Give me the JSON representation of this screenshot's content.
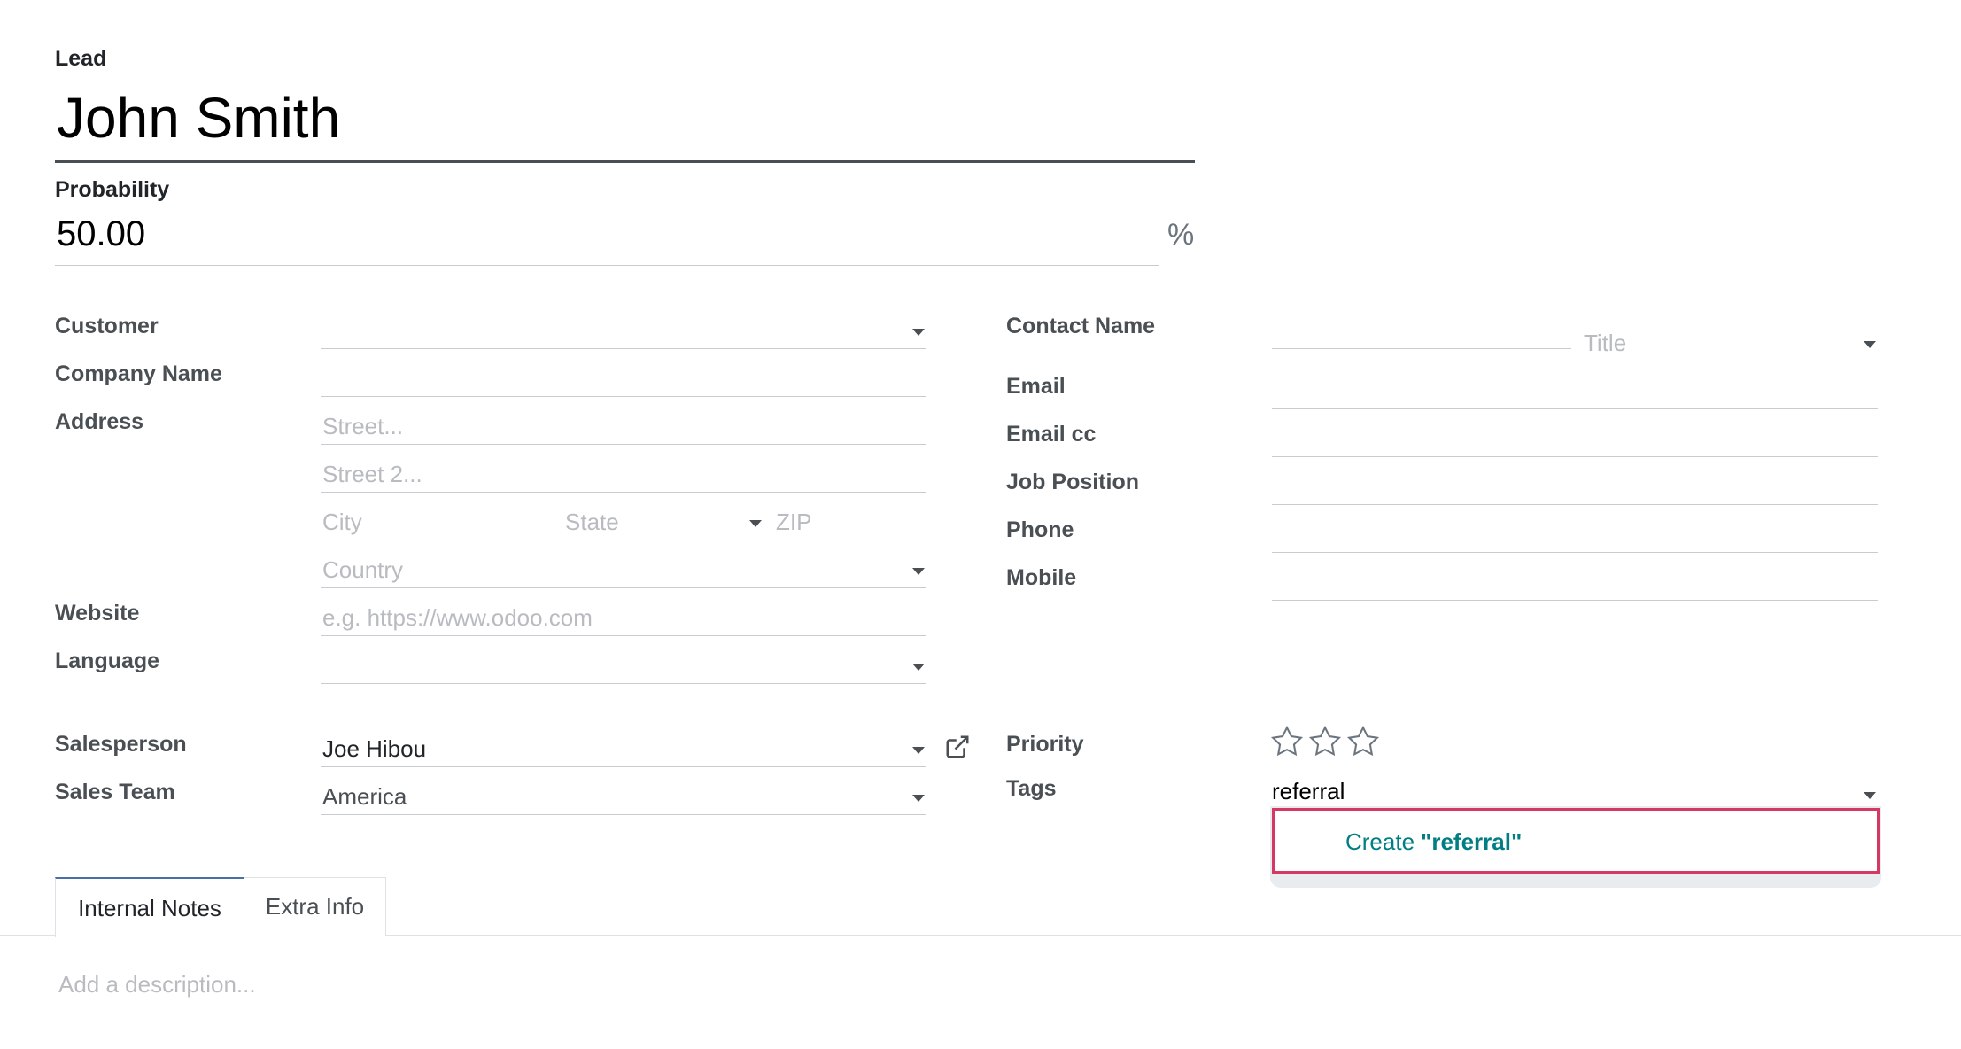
{
  "lead": {
    "label": "Lead",
    "name": "John Smith"
  },
  "probability": {
    "label": "Probability",
    "value": "50.00",
    "unit": "%"
  },
  "left_fields": {
    "customer_label": "Customer",
    "company_name_label": "Company Name",
    "address_label": "Address",
    "street_placeholder": "Street...",
    "street2_placeholder": "Street 2...",
    "city_placeholder": "City",
    "state_placeholder": "State",
    "zip_placeholder": "ZIP",
    "country_placeholder": "Country",
    "website_label": "Website",
    "website_placeholder": "e.g. https://www.odoo.com",
    "language_label": "Language",
    "salesperson_label": "Salesperson",
    "salesperson_value": "Joe Hibou",
    "sales_team_label": "Sales Team",
    "sales_team_value": "America"
  },
  "right_fields": {
    "contact_name_label": "Contact Name",
    "title_placeholder": "Title",
    "email_label": "Email",
    "email_cc_label": "Email cc",
    "job_position_label": "Job Position",
    "phone_label": "Phone",
    "mobile_label": "Mobile",
    "priority_label": "Priority",
    "priority_stars": 0,
    "priority_max": 3,
    "tags_label": "Tags",
    "tags_input": "referral",
    "create_prefix": "Create ",
    "create_value": "\"referral\""
  },
  "tabs": {
    "internal_notes": "Internal Notes",
    "extra_info": "Extra Info",
    "active": "internal_notes"
  },
  "notes": {
    "placeholder": "Add a description..."
  },
  "colors": {
    "accent_teal": "#017e84",
    "highlight_red": "#d63864",
    "label_gray": "#4a4f54",
    "placeholder_gray": "#b8bcc0"
  },
  "icons": {
    "external_link": "external-link-icon",
    "dropdown": "caret-down-icon",
    "star": "star-outline-icon"
  }
}
